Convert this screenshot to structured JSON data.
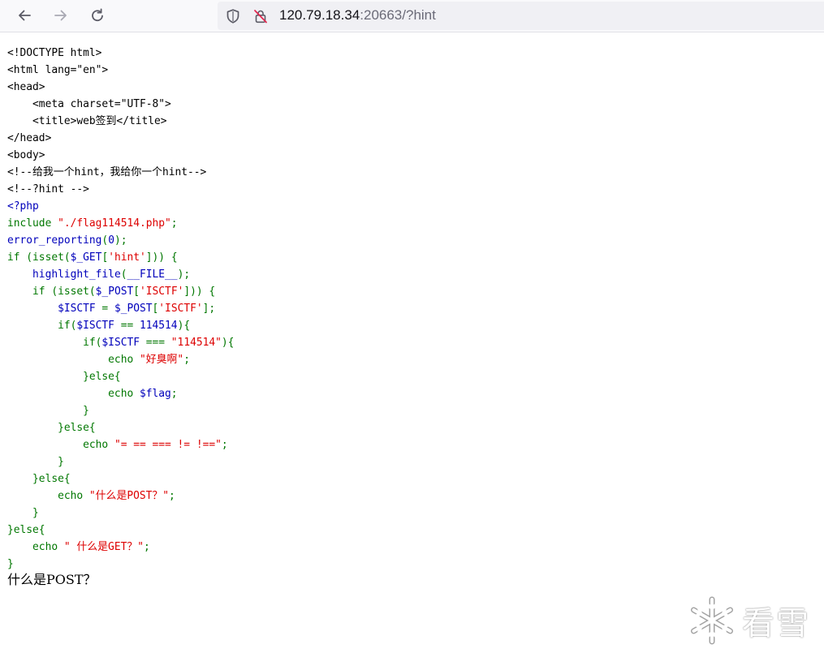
{
  "browser": {
    "url_host": "120.79.18.34",
    "url_rest": ":20663/?hint",
    "icons": {
      "back": "arrow-left-icon",
      "forward": "arrow-right-icon",
      "reload": "reload-icon",
      "shield": "shield-icon",
      "insecure": "insecure-lock-icon"
    }
  },
  "colors": {
    "php_default": "#007700",
    "php_string": "#dd0000",
    "php_keyword": "#0000bb",
    "html_text": "#000000"
  },
  "source_lines": [
    [
      {
        "t": "<!DOCTYPE html>",
        "c": "html"
      }
    ],
    [
      {
        "t": "<html lang=\"en\">",
        "c": "html"
      }
    ],
    [
      {
        "t": "<head>",
        "c": "html"
      }
    ],
    [
      {
        "t": "    <meta charset=\"UTF-8\">",
        "c": "html"
      }
    ],
    [
      {
        "t": "    <title>web签到</title>",
        "c": "html"
      }
    ],
    [
      {
        "t": "</head>",
        "c": "html"
      }
    ],
    [
      {
        "t": "<body>",
        "c": "html"
      }
    ],
    [
      {
        "t": "<!--给我一个hint，我给你一个hint-->",
        "c": "html"
      }
    ],
    [
      {
        "t": "<!--?hint -->",
        "c": "html"
      }
    ],
    [
      {
        "t": "<?php",
        "c": "tag"
      }
    ],
    [
      {
        "t": "include ",
        "c": "def"
      },
      {
        "t": "\"./flag114514.php\"",
        "c": "str"
      },
      {
        "t": ";",
        "c": "def"
      }
    ],
    [
      {
        "t": "error_reporting",
        "c": "tag"
      },
      {
        "t": "(",
        "c": "def"
      },
      {
        "t": "0",
        "c": "tag"
      },
      {
        "t": ");",
        "c": "def"
      }
    ],
    [
      {
        "t": "if (",
        "c": "def"
      },
      {
        "t": "isset",
        "c": "def"
      },
      {
        "t": "(",
        "c": "def"
      },
      {
        "t": "$_GET",
        "c": "tag"
      },
      {
        "t": "[",
        "c": "def"
      },
      {
        "t": "'hint'",
        "c": "str"
      },
      {
        "t": "])) {",
        "c": "def"
      }
    ],
    [
      {
        "t": "    ",
        "c": "def"
      },
      {
        "t": "highlight_file",
        "c": "tag"
      },
      {
        "t": "(",
        "c": "def"
      },
      {
        "t": "__FILE__",
        "c": "tag"
      },
      {
        "t": ");",
        "c": "def"
      }
    ],
    [
      {
        "t": "    if (",
        "c": "def"
      },
      {
        "t": "isset",
        "c": "def"
      },
      {
        "t": "(",
        "c": "def"
      },
      {
        "t": "$_POST",
        "c": "tag"
      },
      {
        "t": "[",
        "c": "def"
      },
      {
        "t": "'ISCTF'",
        "c": "str"
      },
      {
        "t": "])) {",
        "c": "def"
      }
    ],
    [
      {
        "t": "        ",
        "c": "def"
      },
      {
        "t": "$ISCTF ",
        "c": "tag"
      },
      {
        "t": "= ",
        "c": "def"
      },
      {
        "t": "$_POST",
        "c": "tag"
      },
      {
        "t": "[",
        "c": "def"
      },
      {
        "t": "'ISCTF'",
        "c": "str"
      },
      {
        "t": "];",
        "c": "def"
      }
    ],
    [
      {
        "t": "        if(",
        "c": "def"
      },
      {
        "t": "$ISCTF ",
        "c": "tag"
      },
      {
        "t": "== ",
        "c": "def"
      },
      {
        "t": "114514",
        "c": "tag"
      },
      {
        "t": "){",
        "c": "def"
      }
    ],
    [
      {
        "t": "            if(",
        "c": "def"
      },
      {
        "t": "$ISCTF ",
        "c": "tag"
      },
      {
        "t": "=== ",
        "c": "def"
      },
      {
        "t": "\"114514\"",
        "c": "str"
      },
      {
        "t": "){",
        "c": "def"
      }
    ],
    [
      {
        "t": "                echo ",
        "c": "def"
      },
      {
        "t": "\"好臭啊\"",
        "c": "str"
      },
      {
        "t": ";",
        "c": "def"
      }
    ],
    [
      {
        "t": "            }else{",
        "c": "def"
      }
    ],
    [
      {
        "t": "                echo ",
        "c": "def"
      },
      {
        "t": "$flag",
        "c": "tag"
      },
      {
        "t": ";",
        "c": "def"
      }
    ],
    [
      {
        "t": "            }",
        "c": "def"
      }
    ],
    [
      {
        "t": "        }else{",
        "c": "def"
      }
    ],
    [
      {
        "t": "            echo ",
        "c": "def"
      },
      {
        "t": "\"= == === != !==\"",
        "c": "str"
      },
      {
        "t": ";",
        "c": "def"
      }
    ],
    [
      {
        "t": "        }",
        "c": "def"
      }
    ],
    [
      {
        "t": "    }else{",
        "c": "def"
      }
    ],
    [
      {
        "t": "        echo ",
        "c": "def"
      },
      {
        "t": "\"什么是POST？\"",
        "c": "str"
      },
      {
        "t": ";",
        "c": "def"
      }
    ],
    [
      {
        "t": "    }",
        "c": "def"
      }
    ],
    [
      {
        "t": "}else{",
        "c": "def"
      }
    ],
    [
      {
        "t": "    echo ",
        "c": "def"
      },
      {
        "t": "\" 什么是GET？\"",
        "c": "str"
      },
      {
        "t": ";",
        "c": "def"
      }
    ],
    [
      {
        "t": "}",
        "c": "def"
      }
    ]
  ],
  "output_text": "什么是POST？",
  "watermark": {
    "text": "看雪",
    "icon": "snowflake-icon"
  }
}
